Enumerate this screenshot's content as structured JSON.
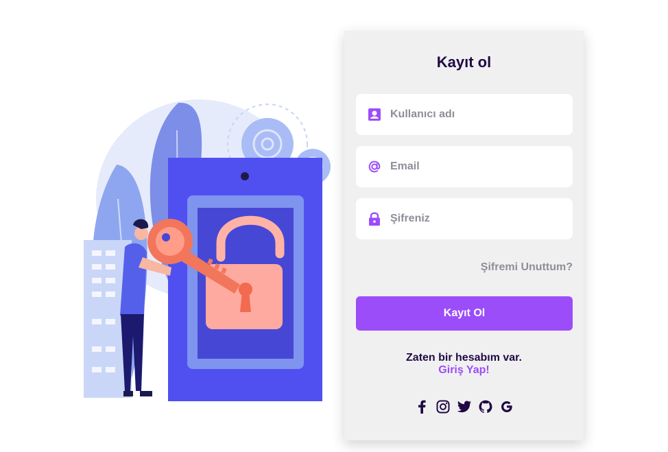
{
  "form": {
    "title": "Kayıt ol",
    "username_placeholder": "Kullanıcı adı",
    "email_placeholder": "Email",
    "password_placeholder": "Şifreniz",
    "forgot_label": "Şifremi Unuttum?",
    "submit_label": "Kayıt Ol",
    "already_text": "Zaten bir hesabım var.",
    "login_link": "Giriş Yap!"
  },
  "socials": [
    "facebook-icon",
    "instagram-icon",
    "twitter-icon",
    "github-icon",
    "google-icon"
  ],
  "colors": {
    "accent": "#9b4df9",
    "panel_bg": "#f1f0f1",
    "title": "#1f0a44",
    "muted": "#8e8e99"
  }
}
